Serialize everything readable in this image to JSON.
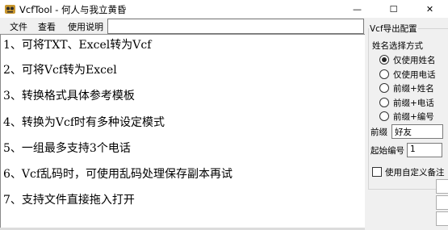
{
  "window": {
    "title": "VcfTool - 何人与我立黄昏",
    "minimize_glyph": "—",
    "maximize_glyph": "☐",
    "close_glyph": "✕"
  },
  "menu": {
    "items": [
      {
        "label": "文件"
      },
      {
        "label": "查看"
      },
      {
        "label": "使用说明"
      }
    ]
  },
  "path_input": {
    "value": ""
  },
  "main": {
    "lines": [
      "1、可将TXT、Excel转为Vcf",
      "2、可将Vcf转为Excel",
      "3、转换格式具体参考模板",
      "4、转换为Vcf时有多种设定模式",
      "5、一组最多支持3个电话",
      "6、Vcf乱码时，可使用乱码处理保存副本再试",
      "7、支持文件直接拖入打开"
    ]
  },
  "settings": {
    "group_title": "Vcf导出配置",
    "name_mode_label": "姓名选择方式",
    "options": [
      {
        "label": "仅使用姓名",
        "checked": true
      },
      {
        "label": "仅使用电话",
        "checked": false
      },
      {
        "label": "前缀+姓名",
        "checked": false
      },
      {
        "label": "前缀+电话",
        "checked": false
      },
      {
        "label": "前缀+编号",
        "checked": false
      }
    ],
    "prefix_label": "前缀",
    "prefix_value": "好友",
    "start_number_label": "起始编号",
    "start_number_value": "1",
    "custom_remark_label": "使用自定义备注",
    "custom_remark_checked": false
  }
}
